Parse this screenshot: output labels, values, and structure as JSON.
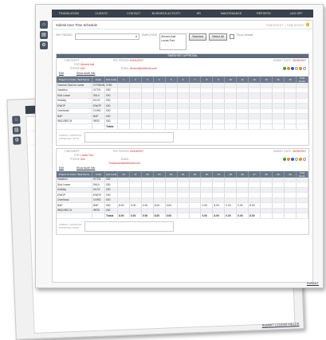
{
  "navigation": {
    "items": [
      "TRANSLATION",
      "CLIENTS",
      "CONTACT",
      "BUSINESS ACTIVITY",
      "HR",
      "MAINTENANCE",
      "REPORTS",
      "LOG OFF"
    ]
  },
  "side_icons": [
    "home-icon",
    "document-icon",
    "settings-icon"
  ],
  "page": {
    "title": "Submit User Time Schedule",
    "header_right_1": "TIMESHEET",
    "header_right_2": "TIMESHEET"
  },
  "filters": {
    "pay_period_label": "PAY PERIOD",
    "pay_period_value": "",
    "employee_label": "EMPLOYEE",
    "employee_lines": [
      "Ahmed Aali",
      "Lucas Tom"
    ],
    "selected_button": "Selected",
    "select_all_button": "Select All",
    "show_details_label": "Show Details"
  },
  "section_header": "TIMESHEET APPROVAL",
  "timesheets": [
    {
      "employee_label": "TIMESHEET FOR",
      "employee_value": "Ahmed Aali",
      "phone_label": "PHONE",
      "phone_value": "N/A",
      "pay_period_label": "PAY PERIOD",
      "pay_period_value": "04/01/2007",
      "email_label": "EMAIL",
      "email_value": "Ahmed@webmail.com",
      "submit_label": "SUBMIT DATE",
      "submit_value": "05/06/2007",
      "edit_label": "Edit",
      "audit_label": "Show Audit Info",
      "columns": [
        "Project or Code / Task Name",
        "Code",
        "Sub Code",
        "1",
        "2",
        "3",
        "4",
        "5",
        "6",
        "7",
        "8",
        "9",
        "10",
        "11",
        "12",
        "13",
        "14",
        "15",
        "Total Hours"
      ],
      "rows": [
        [
          "General Task for name",
          "GTRNNN",
          "0769",
          "",
          "",
          "",
          "",
          "",
          "",
          "",
          "",
          "",
          "",
          "",
          "",
          "",
          "",
          "",
          ""
        ],
        [
          "Vacation",
          "VCTN",
          "000",
          "",
          "",
          "",
          "",
          "",
          "",
          "",
          "",
          "",
          "",
          "",
          "",
          "",
          "",
          "",
          ""
        ],
        [
          "Sick Leave",
          "SKLV",
          "000",
          "",
          "",
          "",
          "",
          "",
          "",
          "",
          "",
          "",
          "",
          "",
          "",
          "",
          "",
          "",
          ""
        ],
        [
          "Holiday",
          "HLDY",
          "000",
          "",
          "",
          "",
          "",
          "",
          "",
          "",
          "",
          "",
          "",
          "",
          "",
          "",
          "",
          "",
          ""
        ],
        [
          "EWOP",
          "EWOP",
          "000",
          "",
          "",
          "",
          "",
          "",
          "",
          "",
          "",
          "",
          "",
          "",
          "",
          "",
          "",
          "",
          ""
        ],
        [
          "Overhead",
          "OVHD",
          "000",
          "",
          "",
          "",
          "",
          "",
          "",
          "",
          "",
          "",
          "",
          "",
          "",
          "",
          "",
          "",
          ""
        ],
        [
          "B&P",
          "B&P",
          "000",
          "",
          "",
          "",
          "",
          "",
          "",
          "",
          "",
          "",
          "",
          "",
          "",
          "",
          "",
          "",
          ""
        ],
        [
          "IR&D/RECH",
          "IRRD",
          "000",
          "",
          "",
          "",
          "",
          "",
          "",
          "",
          "",
          "",
          "",
          "",
          "",
          "",
          "",
          "",
          ""
        ]
      ],
      "totals_label": "Totals",
      "submit_approval_label": "SUBMIT / APPROVE",
      "approval_note_label": "APPROVAL NOTE"
    },
    {
      "employee_label": "TIMESHEET FOR",
      "employee_value": "Lucas Tom",
      "phone_label": "PHONE",
      "phone_value": "N/A",
      "pay_period_label": "PAY PERIOD",
      "pay_period_value": "04/16/2007",
      "email_label": "EMAIL",
      "email_value": "Tlucasman@webmail.com",
      "submit_label": "SUBMIT DATE",
      "submit_value": "05/05/2007",
      "edit_label": "Edit",
      "audit_label": "Show Audit Info",
      "columns": [
        "Project or Code / Task Name",
        "Code",
        "Sub Code",
        "16",
        "17",
        "18",
        "19",
        "20",
        "21",
        "22",
        "23",
        "24",
        "25",
        "26",
        "27",
        "28",
        "29",
        "30",
        "Total Hours"
      ],
      "rows": [
        [
          "Vacation",
          "VCTN",
          "000",
          "",
          "",
          "",
          "",
          "",
          "",
          "",
          "",
          "",
          "",
          "",
          "",
          "",
          "",
          "",
          ""
        ],
        [
          "Sick Leave",
          "SKLV",
          "000",
          "",
          "",
          "",
          "",
          "",
          "",
          "",
          "",
          "",
          "",
          "",
          "",
          "",
          "",
          "",
          ""
        ],
        [
          "Holiday",
          "HLDY",
          "000",
          "",
          "",
          "",
          "",
          "",
          "",
          "",
          "",
          "",
          "",
          "",
          "",
          "",
          "",
          "",
          ""
        ],
        [
          "EWOP",
          "EWOP",
          "000",
          "",
          "",
          "",
          "",
          "",
          "",
          "",
          "",
          "",
          "",
          "",
          "",
          "",
          "",
          "",
          ""
        ],
        [
          "Overhead",
          "OVHD",
          "000",
          "",
          "",
          "",
          "",
          "",
          "",
          "",
          "",
          "",
          "",
          "",
          "",
          "",
          "",
          "",
          ""
        ],
        [
          "B&P",
          "B&P",
          "000",
          "8.00",
          "0.00",
          "0.00",
          "8.00",
          "0.00",
          "",
          "",
          "0.00",
          "8.00",
          "0.00",
          "0.00",
          "8.00",
          "",
          "",
          "",
          ""
        ],
        [
          "IR&D/RECH",
          "IRRD",
          "000",
          "",
          "",
          "",
          "",
          "",
          "",
          "",
          "",
          "",
          "",
          "",
          "",
          "",
          "",
          "",
          ""
        ]
      ],
      "totals_label": "Totals",
      "totals": [
        "8.00",
        "0.00",
        "0.00",
        "8.00",
        "0.00",
        "",
        "",
        "0.00",
        "8.00",
        "0.00",
        "0.00",
        "8.00",
        "",
        "",
        "",
        ""
      ],
      "submit_approval_label": "SUBMIT / APPROVE",
      "approval_note_label": "APPROVAL NOTE"
    }
  ],
  "submit_label": "SUBMIT",
  "back_window": {
    "footer_link": "SUBMIT | CLEAR FIELDS"
  },
  "colors": {
    "nav_bg": "#39414b",
    "header_bg": "#6b7a8b",
    "accent_red": "#cc3333",
    "status_green": "#3aa23a",
    "status_orange": "#f08a1c",
    "status_blue": "#2f5fbf"
  }
}
